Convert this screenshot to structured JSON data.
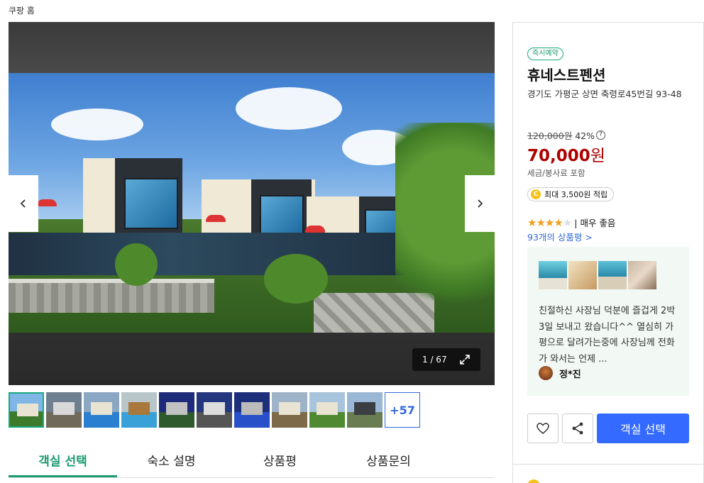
{
  "breadcrumb": "쿠팡 홈",
  "gallery": {
    "counter": "1 / 67",
    "more_label": "+57",
    "thumbnail_count": 10
  },
  "tabs": [
    {
      "label": "객실 선택",
      "active": true
    },
    {
      "label": "숙소 설명",
      "active": false
    },
    {
      "label": "상품평",
      "active": false
    },
    {
      "label": "상품문의",
      "active": false
    }
  ],
  "product": {
    "badge": "즉시예약",
    "name": "휴네스트펜션",
    "address": "경기도 가평군 상면 축령로45번길 93-48",
    "original_price": "120,000원",
    "discount": "42%",
    "help_mark": "?",
    "price_number": "70,000",
    "price_unit": "원",
    "tax_note": "세금/봉사료 포함",
    "points_icon": "C",
    "points": "최대 3,500원 적립",
    "rating_stars": 4,
    "rating_text": "| 매우 좋음",
    "review_count_link": "93개의 상품평 >"
  },
  "review": {
    "text": "친절하신 사장님 덕분에 즐겁게 2박 3일 보내고 왔습니다^^ 열심히 가평으로 달려가는중에 사장님께 전화가 와서는 언제 ...",
    "user": "정*진"
  },
  "actions": {
    "cta": "객실 선택"
  },
  "colors": {
    "accent_green": "#1a9a6f",
    "price_red": "#ae0000",
    "cta_blue": "#346aff",
    "link_blue": "#3369d6"
  }
}
